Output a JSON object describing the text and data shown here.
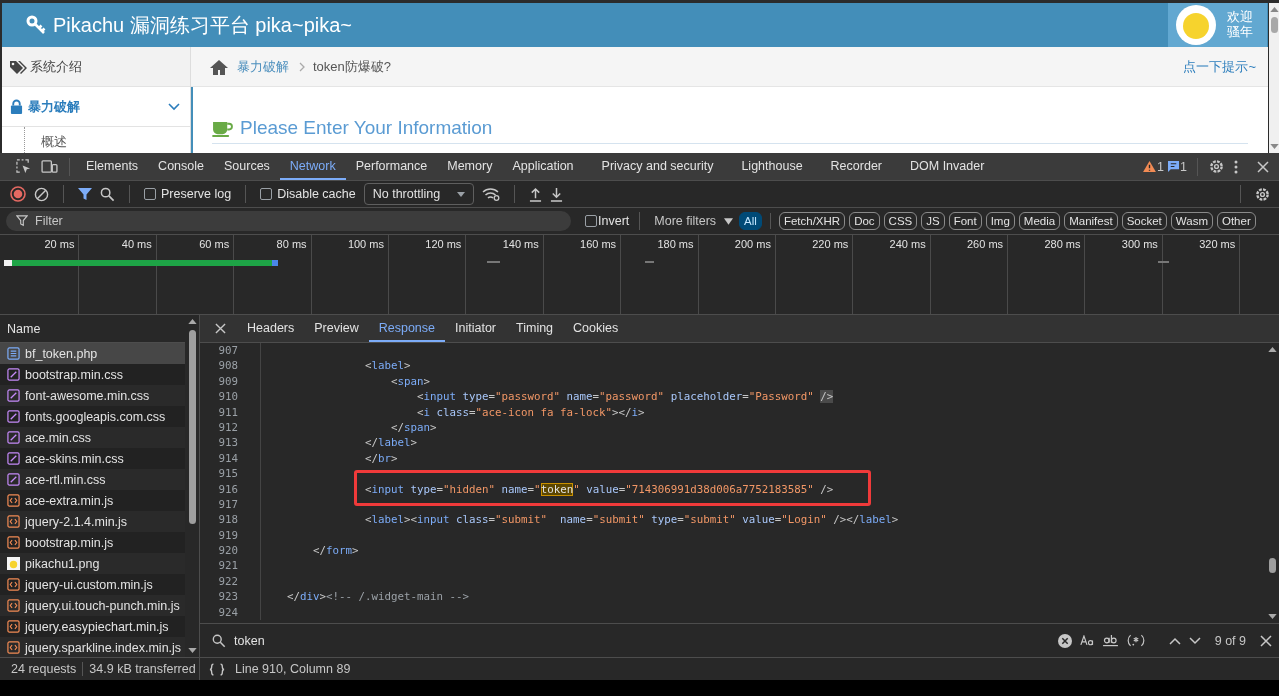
{
  "page": {
    "header": {
      "title": "Pikachu 漏洞练习平台 pika~pika~",
      "greeting": [
        "欢迎",
        "骚年"
      ]
    },
    "sidebar": {
      "items": [
        {
          "kind": "link",
          "label": "系统介绍",
          "selected": false
        },
        {
          "kind": "group",
          "label": "暴力破解",
          "selected": true,
          "expanded": true,
          "children": [
            {
              "label": "概述"
            }
          ]
        }
      ]
    },
    "breadcrumb": {
      "items": [
        {
          "kind": "link",
          "label": "暴力破解"
        },
        {
          "kind": "current",
          "label": "token防爆破?"
        }
      ],
      "hint": "点一下提示~"
    },
    "content": {
      "heading": "Please Enter Your Information"
    }
  },
  "devtools": {
    "tabs": [
      {
        "label": "Elements",
        "selected": false
      },
      {
        "label": "Console",
        "selected": false
      },
      {
        "label": "Sources",
        "selected": false
      },
      {
        "label": "Network",
        "selected": true
      },
      {
        "label": "Performance",
        "selected": false
      },
      {
        "label": "Memory",
        "selected": false
      },
      {
        "label": "Application",
        "selected": false
      },
      {
        "label": "Privacy and security",
        "selected": false
      },
      {
        "label": "Lighthouse",
        "selected": false
      },
      {
        "label": "Recorder",
        "selected": false
      },
      {
        "label": "DOM Invader",
        "selected": false
      }
    ],
    "issues": {
      "warnings": "1",
      "messages": "1"
    },
    "toolbar": {
      "recording": true,
      "filter_shown": true,
      "preserve_log": false,
      "preserve_log_label": "Preserve log",
      "disable_cache": false,
      "disable_cache_label": "Disable cache",
      "throttling": "No throttling"
    },
    "filter_bar": {
      "placeholder": "Filter",
      "invert": false,
      "invert_label": "Invert",
      "more_filters": "More filters",
      "chips": [
        {
          "label": "All",
          "selected": true
        },
        {
          "label": "Fetch/XHR",
          "selected": false
        },
        {
          "label": "Doc",
          "selected": false
        },
        {
          "label": "CSS",
          "selected": false
        },
        {
          "label": "JS",
          "selected": false
        },
        {
          "label": "Font",
          "selected": false
        },
        {
          "label": "Img",
          "selected": false
        },
        {
          "label": "Media",
          "selected": false
        },
        {
          "label": "Manifest",
          "selected": false
        },
        {
          "label": "Socket",
          "selected": false
        },
        {
          "label": "Wasm",
          "selected": false
        },
        {
          "label": "Other",
          "selected": false
        }
      ]
    },
    "timeline": {
      "ticks": [
        "20 ms",
        "40 ms",
        "60 ms",
        "80 ms",
        "100 ms",
        "120 ms",
        "140 ms",
        "160 ms",
        "180 ms",
        "200 ms",
        "220 ms",
        "240 ms",
        "260 ms",
        "280 ms",
        "300 ms",
        "320 ms"
      ]
    },
    "requests": {
      "header": "Name",
      "items": [
        {
          "name": "bf_token.php",
          "kind": "doc",
          "selected": true
        },
        {
          "name": "bootstrap.min.css",
          "kind": "css",
          "selected": false
        },
        {
          "name": "font-awesome.min.css",
          "kind": "css",
          "selected": false
        },
        {
          "name": "fonts.googleapis.com.css",
          "kind": "css",
          "selected": false
        },
        {
          "name": "ace.min.css",
          "kind": "css",
          "selected": false
        },
        {
          "name": "ace-skins.min.css",
          "kind": "css",
          "selected": false
        },
        {
          "name": "ace-rtl.min.css",
          "kind": "css",
          "selected": false
        },
        {
          "name": "ace-extra.min.js",
          "kind": "js",
          "selected": false
        },
        {
          "name": "jquery-2.1.4.min.js",
          "kind": "js",
          "selected": false
        },
        {
          "name": "bootstrap.min.js",
          "kind": "js",
          "selected": false
        },
        {
          "name": "pikachu1.png",
          "kind": "img",
          "selected": false
        },
        {
          "name": "jquery-ui.custom.min.js",
          "kind": "js",
          "selected": false
        },
        {
          "name": "jquery.ui.touch-punch.min.js",
          "kind": "js",
          "selected": false
        },
        {
          "name": "jquery.easypiechart.min.js",
          "kind": "js",
          "selected": false
        },
        {
          "name": "jquery.sparkline.index.min.js",
          "kind": "js",
          "selected": false
        }
      ]
    },
    "detail": {
      "tabs": [
        {
          "label": "Headers",
          "selected": false
        },
        {
          "label": "Preview",
          "selected": false
        },
        {
          "label": "Response",
          "selected": true
        },
        {
          "label": "Initiator",
          "selected": false
        },
        {
          "label": "Timing",
          "selected": false
        },
        {
          "label": "Cookies",
          "selected": false
        }
      ],
      "lines": [
        {
          "num": "907",
          "boxed": false
        },
        {
          "num": "908",
          "boxed": false,
          "tokens": [
            {
              "kind": "p",
              "text": "                <"
            },
            {
              "kind": "tag",
              "text": "label"
            },
            {
              "kind": "p",
              "text": ">"
            }
          ]
        },
        {
          "num": "909",
          "boxed": false,
          "tokens": [
            {
              "kind": "p",
              "text": "                    <"
            },
            {
              "kind": "tag",
              "text": "span"
            },
            {
              "kind": "p",
              "text": ">"
            }
          ]
        },
        {
          "num": "910",
          "boxed": false,
          "tokens": [
            {
              "kind": "p",
              "text": "                        <"
            },
            {
              "kind": "tag",
              "text": "input"
            },
            {
              "kind": "attr",
              "text": " type"
            },
            {
              "kind": "p",
              "text": "="
            },
            {
              "kind": "value",
              "text": "\"password\""
            },
            {
              "kind": "attr",
              "text": " name"
            },
            {
              "kind": "p",
              "text": "="
            },
            {
              "kind": "value",
              "text": "\"password\""
            },
            {
              "kind": "attr",
              "text": " placeholder"
            },
            {
              "kind": "p",
              "text": "="
            },
            {
              "kind": "value",
              "text": "\"Password\" "
            },
            {
              "kind": "cursor",
              "text": "/>"
            }
          ]
        },
        {
          "num": "911",
          "boxed": false,
          "tokens": [
            {
              "kind": "p",
              "text": "                        <"
            },
            {
              "kind": "tag",
              "text": "i"
            },
            {
              "kind": "attr",
              "text": " class"
            },
            {
              "kind": "p",
              "text": "="
            },
            {
              "kind": "value",
              "text": "\"ace-icon fa fa-lock\""
            },
            {
              "kind": "p",
              "text": "></"
            },
            {
              "kind": "tag",
              "text": "i"
            },
            {
              "kind": "p",
              "text": ">"
            }
          ]
        },
        {
          "num": "912",
          "boxed": false,
          "tokens": [
            {
              "kind": "p",
              "text": "                    </"
            },
            {
              "kind": "tag",
              "text": "span"
            },
            {
              "kind": "p",
              "text": ">"
            }
          ]
        },
        {
          "num": "913",
          "boxed": false,
          "tokens": [
            {
              "kind": "p",
              "text": "                </"
            },
            {
              "kind": "tag",
              "text": "label"
            },
            {
              "kind": "p",
              "text": ">"
            }
          ]
        },
        {
          "num": "914",
          "boxed": false,
          "tokens": [
            {
              "kind": "p",
              "text": "                </"
            },
            {
              "kind": "tag",
              "text": "br"
            },
            {
              "kind": "p",
              "text": ">"
            }
          ]
        },
        {
          "num": "915",
          "boxed": false
        },
        {
          "num": "916",
          "boxed": true,
          "tokens": [
            {
              "kind": "p",
              "text": "                <"
            },
            {
              "kind": "tag",
              "text": "input"
            },
            {
              "kind": "attr",
              "text": " type"
            },
            {
              "kind": "p",
              "text": "="
            },
            {
              "kind": "value",
              "text": "\"hidden\""
            },
            {
              "kind": "attr",
              "text": " name"
            },
            {
              "kind": "p",
              "text": "="
            },
            {
              "kind": "value",
              "text": "\""
            },
            {
              "kind": "match",
              "text": "token"
            },
            {
              "kind": "value",
              "text": "\""
            },
            {
              "kind": "attr",
              "text": " value"
            },
            {
              "kind": "p",
              "text": "="
            },
            {
              "kind": "value",
              "text": "\"714306991d38d006a7752183585\""
            },
            {
              "kind": "p",
              "text": " />"
            }
          ]
        },
        {
          "num": "917",
          "boxed": false
        },
        {
          "num": "918",
          "boxed": false,
          "tokens": [
            {
              "kind": "p",
              "text": "                <"
            },
            {
              "kind": "tag",
              "text": "label"
            },
            {
              "kind": "p",
              "text": "><"
            },
            {
              "kind": "tag",
              "text": "input"
            },
            {
              "kind": "attr",
              "text": " class"
            },
            {
              "kind": "p",
              "text": "="
            },
            {
              "kind": "value",
              "text": "\"submit\""
            },
            {
              "kind": "attr",
              "text": "  name"
            },
            {
              "kind": "p",
              "text": "="
            },
            {
              "kind": "value",
              "text": "\"submit\""
            },
            {
              "kind": "attr",
              "text": " type"
            },
            {
              "kind": "p",
              "text": "="
            },
            {
              "kind": "value",
              "text": "\"submit\""
            },
            {
              "kind": "attr",
              "text": " value"
            },
            {
              "kind": "p",
              "text": "="
            },
            {
              "kind": "value",
              "text": "\"Login\""
            },
            {
              "kind": "p",
              "text": " /></"
            },
            {
              "kind": "tag",
              "text": "label"
            },
            {
              "kind": "p",
              "text": ">"
            }
          ]
        },
        {
          "num": "919",
          "boxed": false
        },
        {
          "num": "920",
          "boxed": false,
          "tokens": [
            {
              "kind": "p",
              "text": "        </"
            },
            {
              "kind": "tag",
              "text": "form"
            },
            {
              "kind": "p",
              "text": ">"
            }
          ]
        },
        {
          "num": "921",
          "boxed": false
        },
        {
          "num": "922",
          "boxed": false
        },
        {
          "num": "923",
          "boxed": false,
          "tokens": [
            {
              "kind": "p",
              "text": "    </"
            },
            {
              "kind": "tag",
              "text": "div"
            },
            {
              "kind": "p",
              "text": ">"
            },
            {
              "kind": "comment",
              "text": "<!-- /.widget-main -->"
            }
          ]
        },
        {
          "num": "924",
          "boxed": false
        }
      ],
      "search": {
        "value": "token",
        "count": "9 of 9"
      }
    },
    "status": {
      "requests": "24 requests",
      "transferred": "34.9 kB transferred",
      "position": "Line 910, Column 89"
    }
  }
}
